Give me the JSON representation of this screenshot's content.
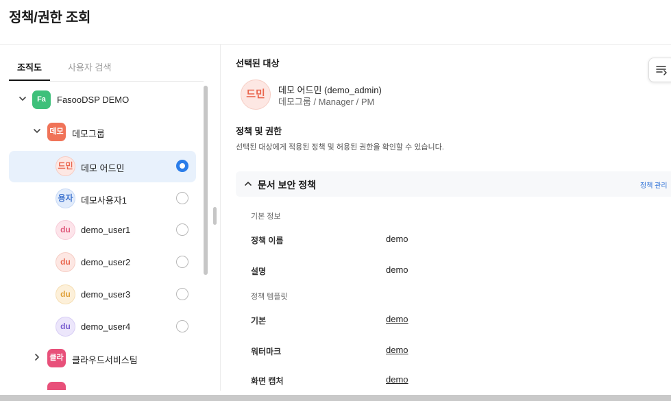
{
  "page": {
    "title": "정책/권한 조회"
  },
  "left": {
    "tabs": [
      {
        "label": "조직도",
        "active": true
      },
      {
        "label": "사용자 검색",
        "active": false
      }
    ],
    "tree": {
      "root": {
        "badge": "Fa",
        "label": "FasooDSP DEMO",
        "color": "#3ec07a"
      },
      "group": {
        "badge": "데모",
        "label": "데모그룹",
        "color": "#f07358"
      },
      "users": [
        {
          "avatar": "드민",
          "label": "데모 어드민",
          "bg": "#fde7e3",
          "fg": "#e9664e",
          "selected": true
        },
        {
          "avatar": "용자",
          "label": "데모사용자1",
          "bg": "#e2ecfb",
          "fg": "#3f74cf",
          "selected": false
        },
        {
          "avatar": "du",
          "label": "demo_user1",
          "bg": "#fde4ea",
          "fg": "#e0587b",
          "selected": false
        },
        {
          "avatar": "du",
          "label": "demo_user2",
          "bg": "#fde7e3",
          "fg": "#e9664e",
          "selected": false
        },
        {
          "avatar": "du",
          "label": "demo_user3",
          "bg": "#fdf0d9",
          "fg": "#e0a13a",
          "selected": false
        },
        {
          "avatar": "du",
          "label": "demo_user4",
          "bg": "#ece6fb",
          "fg": "#7a5fd0",
          "selected": false
        }
      ],
      "collapsed_group": {
        "badge": "클라",
        "label": "클라우드서비스팀",
        "color": "#e8507a"
      },
      "partial_badge_color": "#e8507a"
    }
  },
  "right": {
    "selected_title": "선택된 대상",
    "selected": {
      "avatar": "드민",
      "name": "데모 어드민 (demo_admin)",
      "path": "데모그룹 / Manager / PM"
    },
    "policy_title": "정책 및 권한",
    "policy_desc": "선택된 대상에게 적용된 정책 및 허용된 권한을 확인할 수 있습니다.",
    "accordion": {
      "title": "문서 보안 정책",
      "manage_link": "정책 관리",
      "basic_info_label": "기본 정보",
      "policy_name_label": "정책 이름",
      "policy_name_value": "demo",
      "description_label": "설명",
      "description_value": "demo",
      "template_label": "정책 템플릿",
      "templates": [
        {
          "label": "기본",
          "value": "demo"
        },
        {
          "label": "워터마크",
          "value": "demo"
        },
        {
          "label": "화면 캡처",
          "value": "demo"
        }
      ]
    }
  },
  "colors": {
    "accent": "#2b7de9",
    "selected_row": "#e8f1fc",
    "link": "#2b6fd6"
  }
}
